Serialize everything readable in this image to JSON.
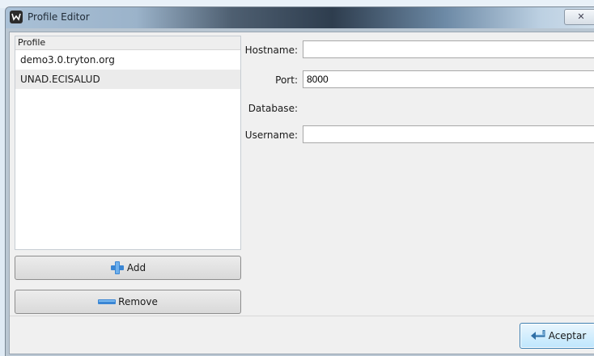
{
  "window": {
    "title": "Profile Editor",
    "close_symbol": "✕",
    "app_icon": "tryton-logo-icon"
  },
  "profiles": {
    "header": "Profile",
    "items": [
      "demo3.0.tryton.org",
      "UNAD.ECISALUD"
    ]
  },
  "buttons": {
    "add_label": "Add",
    "add_icon": "plus-icon",
    "remove_label": "Remove",
    "remove_icon": "minus-icon",
    "accept_label": "Aceptar",
    "accept_icon": "return-arrow-icon"
  },
  "form": {
    "hostname_label": "Hostname:",
    "hostname_value": "",
    "port_label": "Port:",
    "port_value": "8000",
    "database_label": "Database:",
    "username_label": "Username:",
    "username_value": ""
  },
  "colors": {
    "accent_blue": "#3c7fb1",
    "plus_icon": "#3a86d4"
  }
}
